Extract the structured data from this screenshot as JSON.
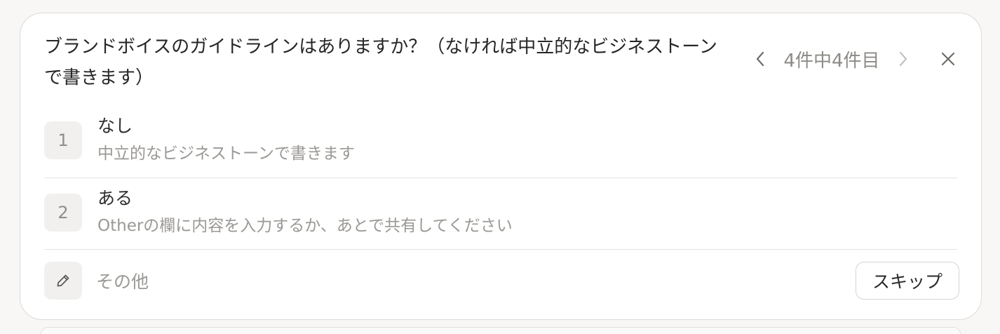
{
  "question": "ブランドボイスのガイドラインはありますか？（なければ中立的なビジネストーンで書きます）",
  "pager": {
    "counter": "4件中4件目",
    "prev_icon": "chevron-left-icon",
    "next_icon": "chevron-right-icon"
  },
  "close_icon": "close-icon",
  "options": [
    {
      "number": "1",
      "title": "なし",
      "description": "中立的なビジネストーンで書きます"
    },
    {
      "number": "2",
      "title": "ある",
      "description": "Otherの欄に内容を入力するか、あとで共有してください"
    }
  ],
  "other": {
    "icon": "pencil-icon",
    "placeholder": "その他",
    "value": ""
  },
  "skip_label": "スキップ",
  "colors": {
    "page_background": "#f8f7f5",
    "card_background": "#ffffff",
    "badge_background": "#f1f0ee",
    "muted_text": "#9b9995"
  }
}
